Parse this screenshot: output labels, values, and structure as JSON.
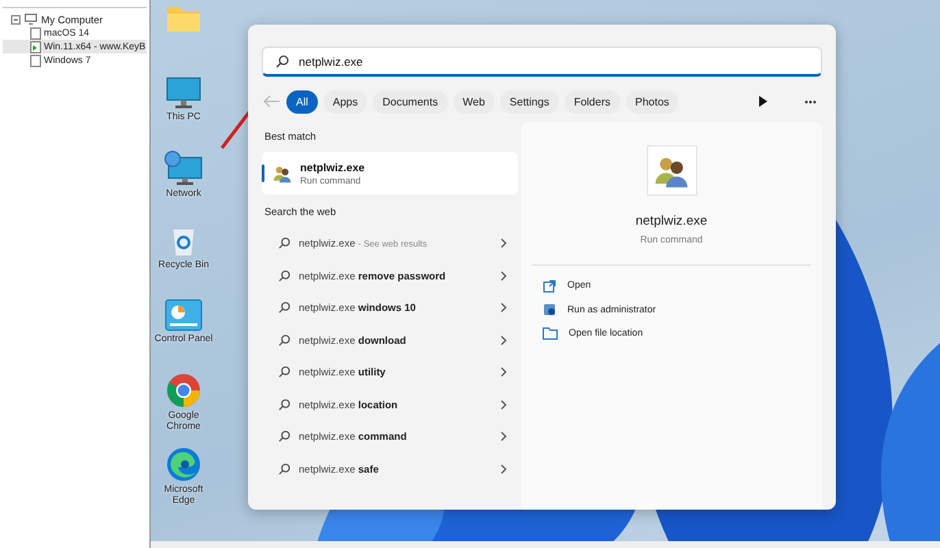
{
  "tree": {
    "label": "My Computer",
    "expanded": true,
    "children": [
      {
        "label": "macOS 14",
        "running": false,
        "selected": false
      },
      {
        "label": "Win.11.x64 - www.KeyB",
        "running": true,
        "selected": true
      },
      {
        "label": "Windows 7",
        "running": false,
        "selected": false
      }
    ]
  },
  "desktop_icons": [
    {
      "kind": "folder"
    },
    {
      "kind": "pc",
      "label": "This PC"
    },
    {
      "kind": "network",
      "label": "Network"
    },
    {
      "kind": "bin",
      "label": "Recycle Bin"
    },
    {
      "kind": "panel",
      "label": "Control Panel"
    },
    {
      "kind": "chrome",
      "label": "Google Chrome"
    },
    {
      "kind": "edge",
      "label": "Microsoft Edge"
    }
  ],
  "search": {
    "value": "netplwiz.exe"
  },
  "filters": [
    {
      "label": "All",
      "selected": true
    },
    {
      "label": "Apps",
      "selected": false
    },
    {
      "label": "Documents",
      "selected": false
    },
    {
      "label": "Web",
      "selected": false
    },
    {
      "label": "Settings",
      "selected": false
    },
    {
      "label": "Folders",
      "selected": false
    },
    {
      "label": "Photos",
      "selected": false
    }
  ],
  "best_match": {
    "heading": "Best match",
    "title": "netplwiz.exe",
    "subtitle": "Run command",
    "selected": true
  },
  "web": {
    "heading": "Search the web",
    "results": [
      {
        "text": "netplwiz.exe",
        "hint": "- See web results"
      },
      {
        "text": "netplwiz.exe **remove password**"
      },
      {
        "text": "netplwiz.exe **windows 10**"
      },
      {
        "text": "netplwiz.exe **download**"
      },
      {
        "text": "netplwiz.exe **utility**"
      },
      {
        "text": "netplwiz.exe **location**"
      },
      {
        "text": "netplwiz.exe **command**"
      },
      {
        "text": "netplwiz.exe **safe**"
      }
    ]
  },
  "preview": {
    "title": "netplwiz.exe",
    "subtitle": "Run command",
    "actions": [
      {
        "kind": "open",
        "label": "Open"
      },
      {
        "kind": "admin",
        "label": "Run as administrator"
      },
      {
        "kind": "folder",
        "label": "Open file location"
      }
    ]
  }
}
